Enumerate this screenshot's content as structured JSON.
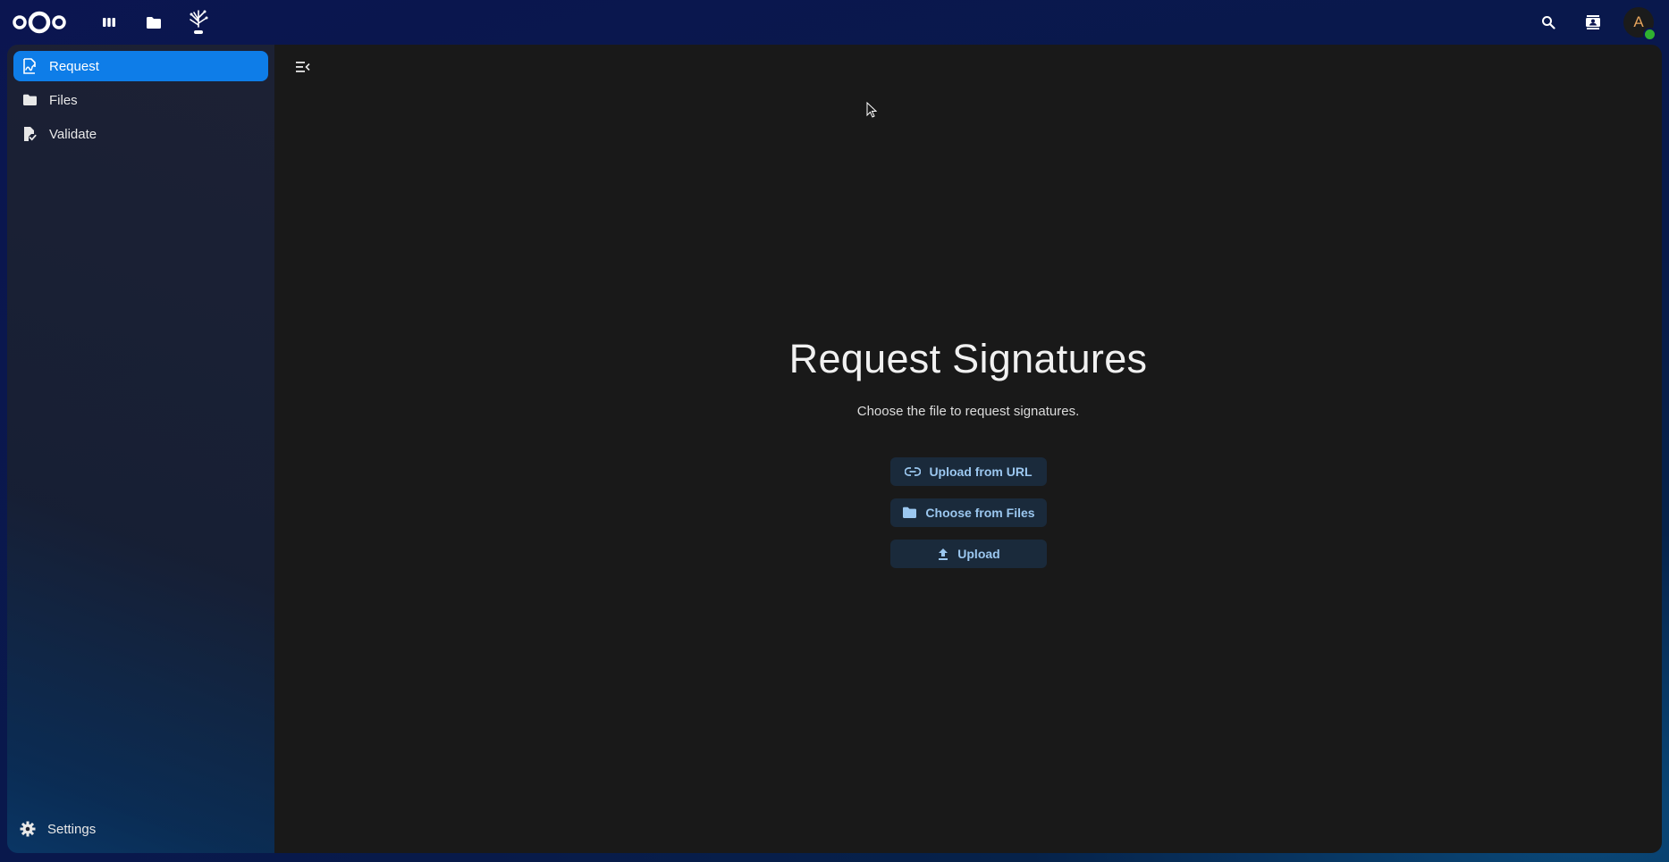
{
  "header": {
    "apps": [
      {
        "name": "dashboard",
        "icon": "dashboard-icon"
      },
      {
        "name": "files",
        "icon": "folder-icon"
      },
      {
        "name": "libresign",
        "icon": "libresign-icon"
      }
    ],
    "right": [
      {
        "icon": "search-icon"
      },
      {
        "icon": "contacts-icon"
      }
    ],
    "avatar_initial": "A",
    "status_color": "#2fb130"
  },
  "nav": {
    "items": [
      {
        "label": "Request",
        "icon": "signature-icon",
        "active": true
      },
      {
        "label": "Files",
        "icon": "folder-icon",
        "active": false
      },
      {
        "label": "Validate",
        "icon": "file-check-icon",
        "active": false
      }
    ],
    "settings_label": "Settings"
  },
  "main": {
    "title": "Request Signatures",
    "subtitle": "Choose the file to request signatures.",
    "buttons": [
      {
        "label": "Upload from URL",
        "icon": "link-icon"
      },
      {
        "label": "Choose from Files",
        "icon": "folder-icon"
      },
      {
        "label": "Upload",
        "icon": "upload-icon"
      }
    ]
  },
  "colors": {
    "accent": "#0e7de8",
    "button_bg": "#1a2a3b",
    "button_text": "#9bc7ef",
    "content_bg": "#191919"
  }
}
